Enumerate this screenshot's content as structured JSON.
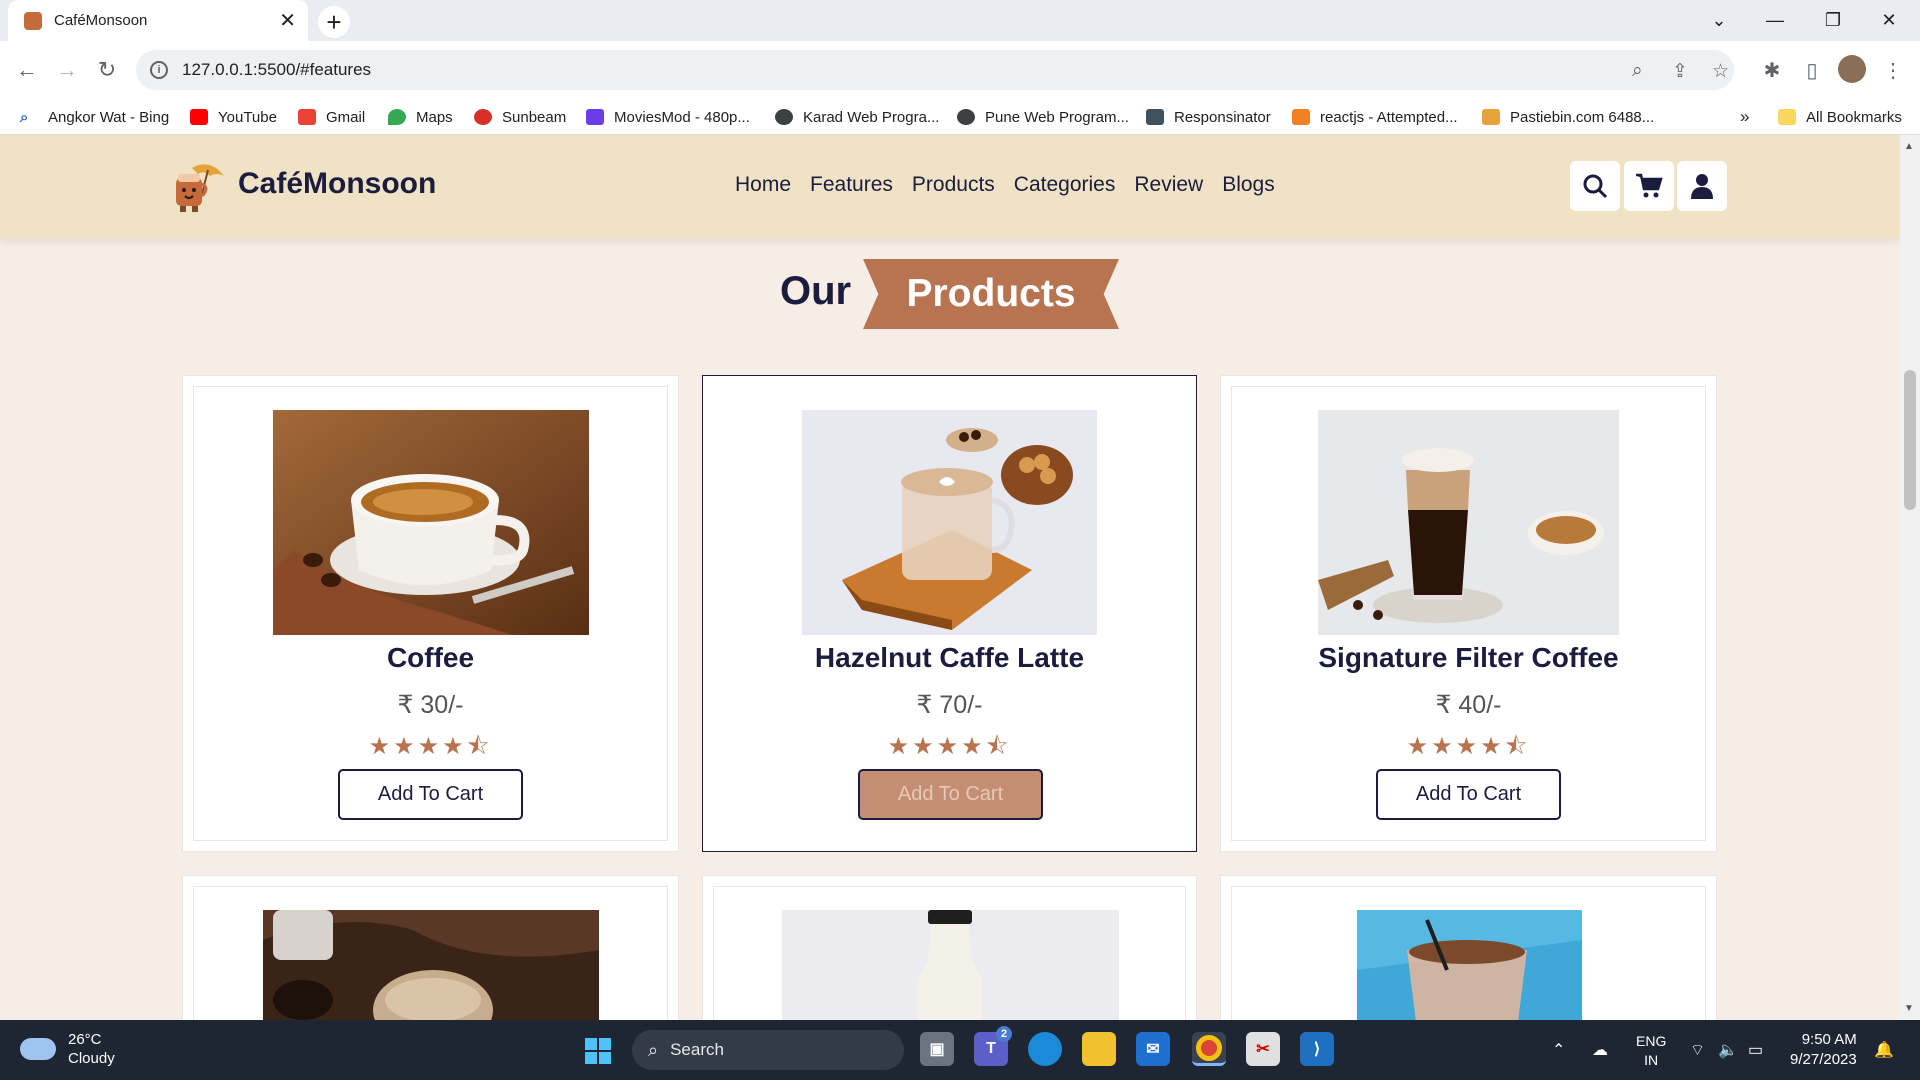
{
  "browser": {
    "tab_title": "CaféMonsoon",
    "url": "127.0.0.1:5500/#features",
    "bookmarks": [
      {
        "label": "Angkor Wat - Bing",
        "icon": "search-icon"
      },
      {
        "label": "YouTube",
        "icon": "youtube-icon"
      },
      {
        "label": "Gmail",
        "icon": "gmail-icon"
      },
      {
        "label": "Maps",
        "icon": "maps-icon"
      },
      {
        "label": "Sunbeam",
        "icon": "sunbeam-icon"
      },
      {
        "label": "MoviesMod - 480p...",
        "icon": "moviesmod-icon"
      },
      {
        "label": "Karad Web Progra...",
        "icon": "globe-icon"
      },
      {
        "label": "Pune Web Program...",
        "icon": "globe-icon"
      },
      {
        "label": "Responsinator",
        "icon": "responsinator-icon"
      },
      {
        "label": "reactjs - Attempted...",
        "icon": "stackoverflow-icon"
      },
      {
        "label": "Pastiebin.com 6488...",
        "icon": "pastebin-icon"
      }
    ],
    "all_bookmarks": "All Bookmarks"
  },
  "site": {
    "brand": "CaféMonsoon",
    "nav": [
      "Home",
      "Features",
      "Products",
      "Categories",
      "Review",
      "Blogs"
    ],
    "heading_our": "Our",
    "heading_products": "Products",
    "products": [
      {
        "name": "Coffee",
        "price": "₹ 30/-",
        "stars": "★★★★⯪",
        "button": "Add To Cart"
      },
      {
        "name": "Hazelnut Caffe Latte",
        "price": "₹ 70/-",
        "stars": "★★★★⯪",
        "button": "Add To Cart"
      },
      {
        "name": "Signature Filter Coffee",
        "price": "₹ 40/-",
        "stars": "★★★★⯪",
        "button": "Add To Cart"
      }
    ],
    "colors": {
      "accent": "#b87450",
      "header_bg": "#efe2c5",
      "dark": "#1b1c3e",
      "page_bg": "#f6ede6"
    }
  },
  "taskbar": {
    "temp": "26°C",
    "weather": "Cloudy",
    "search": "Search",
    "lang_1": "ENG",
    "lang_2": "IN",
    "time": "9:50 AM",
    "date": "9/27/2023",
    "teams_badge": "2"
  }
}
